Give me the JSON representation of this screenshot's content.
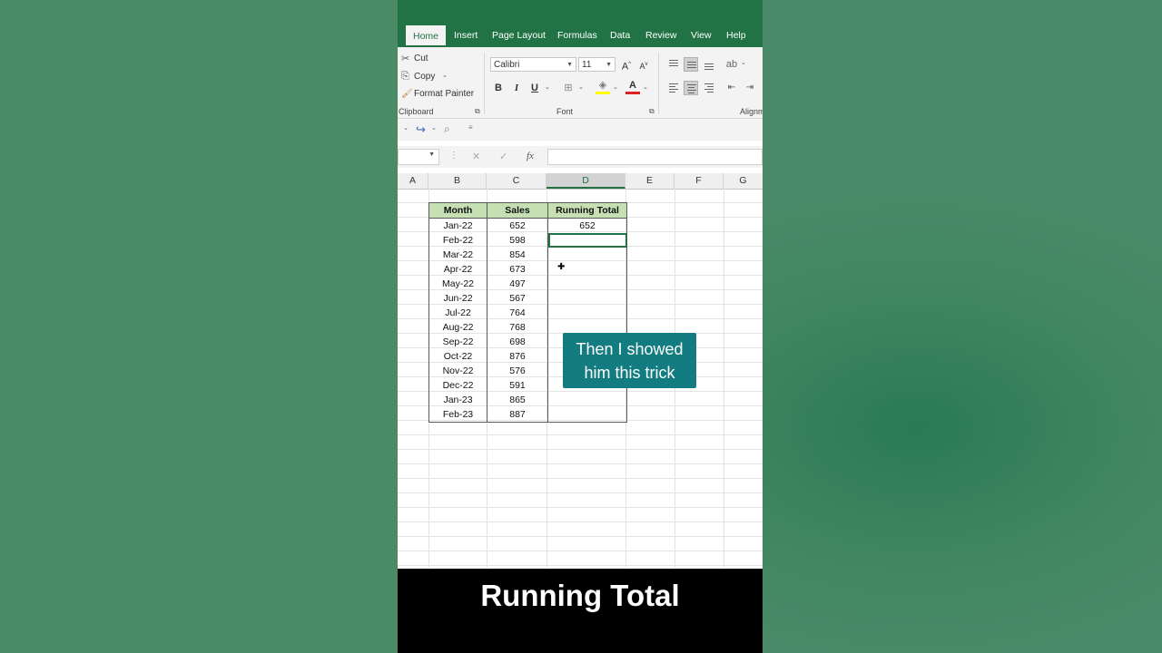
{
  "tabs": [
    "Home",
    "Insert",
    "Page Layout",
    "Formulas",
    "Data",
    "Review",
    "View",
    "Help"
  ],
  "clipboard": {
    "cut_label": "Cut",
    "copy_label": "Copy",
    "format_painter_label": "Format Painter",
    "group_label": "Clipboard"
  },
  "font": {
    "name": "Calibri",
    "size": "11",
    "group_label": "Font",
    "bold": "B",
    "italic": "I",
    "underline": "U",
    "grow": "A",
    "shrink": "A",
    "font_color": "A"
  },
  "alignment": {
    "group_label": "Alignm"
  },
  "formula_bar": {
    "fx": "fx",
    "cancel": "✕",
    "enter": "✓"
  },
  "columns": [
    "A",
    "B",
    "C",
    "D",
    "E",
    "F",
    "G"
  ],
  "table": {
    "headers": [
      "Month",
      "Sales",
      "Running Total"
    ],
    "rows": [
      [
        "Jan-22",
        "652",
        "652"
      ],
      [
        "Feb-22",
        "598",
        ""
      ],
      [
        "Mar-22",
        "854",
        ""
      ],
      [
        "Apr-22",
        "673",
        ""
      ],
      [
        "May-22",
        "497",
        ""
      ],
      [
        "Jun-22",
        "567",
        ""
      ],
      [
        "Jul-22",
        "764",
        ""
      ],
      [
        "Aug-22",
        "768",
        ""
      ],
      [
        "Sep-22",
        "698",
        ""
      ],
      [
        "Oct-22",
        "876",
        ""
      ],
      [
        "Nov-22",
        "576",
        ""
      ],
      [
        "Dec-22",
        "591",
        ""
      ],
      [
        "Jan-23",
        "865",
        ""
      ],
      [
        "Feb-23",
        "887",
        ""
      ]
    ]
  },
  "caption": "Then I showed him this trick",
  "title": "Running Total",
  "colors": {
    "excel_green": "#217346",
    "header_fill": "#c6e0b4",
    "caption_bg": "#127c80"
  }
}
